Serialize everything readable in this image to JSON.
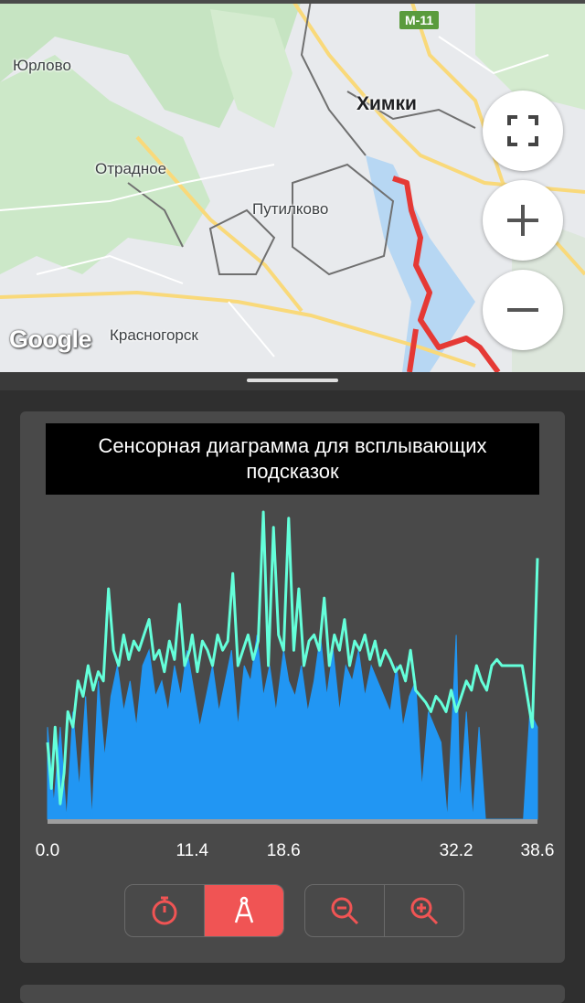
{
  "map": {
    "labels": {
      "yurlovo": "Юрлово",
      "otradnoe": "Отрадное",
      "khimki": "Химки",
      "putilkovo": "Путилково",
      "krasnogorsk": "Красногорск"
    },
    "road_shield": "M-11",
    "logo": "Google",
    "buttons": {
      "fullscreen_icon": "fullscreen-icon",
      "zoom_in_icon": "plus-icon",
      "zoom_out_icon": "minus-icon"
    },
    "track_color": "#e53935"
  },
  "chart_data": {
    "type": "area",
    "title": "Сенсорная диаграмма для всплывающих подсказок",
    "xlabel": "",
    "ylabel": "",
    "xlim": [
      0.0,
      38.6
    ],
    "x_ticks": [
      "0.0",
      "11.4",
      "18.6",
      "32.2",
      "38.6"
    ],
    "grid": false,
    "series": [
      {
        "color": "#2196f3",
        "fill": true,
        "x": [
          0.0,
          0.5,
          1.0,
          1.5,
          2.0,
          2.5,
          3.0,
          3.5,
          4.0,
          4.5,
          5.0,
          5.5,
          6.0,
          6.5,
          7.0,
          7.5,
          8.0,
          8.5,
          9.0,
          9.5,
          10.0,
          10.5,
          11.0,
          11.4,
          12.0,
          12.5,
          13.0,
          13.5,
          14.0,
          14.5,
          15.0,
          15.5,
          16.0,
          16.5,
          17.0,
          17.5,
          18.0,
          18.6,
          19.0,
          19.5,
          20.0,
          20.5,
          21.0,
          21.5,
          22.0,
          22.5,
          23.0,
          23.5,
          24.0,
          24.5,
          25.0,
          25.5,
          26.0,
          26.5,
          27.0,
          27.5,
          28.0,
          28.5,
          29.0,
          29.5,
          30.0,
          30.5,
          31.0,
          31.5,
          32.2,
          32.5,
          33.0,
          33.5,
          34.0,
          34.5,
          35.0,
          35.5,
          36.0,
          36.5,
          37.0,
          37.5,
          38.0,
          38.6
        ],
        "y": [
          0.3,
          0.05,
          0.3,
          0.0,
          0.35,
          0.1,
          0.4,
          0.0,
          0.45,
          0.2,
          0.4,
          0.5,
          0.35,
          0.45,
          0.3,
          0.5,
          0.55,
          0.4,
          0.45,
          0.35,
          0.5,
          0.4,
          0.55,
          0.45,
          0.3,
          0.4,
          0.5,
          0.35,
          0.45,
          0.55,
          0.3,
          0.5,
          0.45,
          0.6,
          0.4,
          0.5,
          0.35,
          0.55,
          0.45,
          0.4,
          0.5,
          0.35,
          0.45,
          0.6,
          0.4,
          0.55,
          0.35,
          0.5,
          0.45,
          0.55,
          0.4,
          0.5,
          0.45,
          0.4,
          0.35,
          0.5,
          0.3,
          0.4,
          0.45,
          0.1,
          0.35,
          0.3,
          0.25,
          0.0,
          0.6,
          0.05,
          0.35,
          0.0,
          0.3,
          0.0,
          0.0,
          0.0,
          0.0,
          0.0,
          0.0,
          0.0,
          0.35,
          0.3
        ]
      },
      {
        "color": "#64ffda",
        "fill": false,
        "x": [
          0.0,
          0.3,
          0.6,
          1.0,
          1.3,
          1.6,
          2.0,
          2.4,
          2.8,
          3.2,
          3.6,
          4.0,
          4.4,
          4.8,
          5.2,
          5.6,
          6.0,
          6.4,
          6.8,
          7.2,
          7.6,
          8.0,
          8.4,
          8.8,
          9.2,
          9.6,
          10.0,
          10.4,
          10.8,
          11.2,
          11.4,
          11.8,
          12.2,
          12.6,
          13.0,
          13.4,
          13.8,
          14.2,
          14.6,
          15.0,
          15.4,
          15.8,
          16.2,
          16.6,
          17.0,
          17.4,
          17.8,
          18.2,
          18.6,
          19.0,
          19.4,
          19.8,
          20.2,
          20.6,
          21.0,
          21.4,
          21.8,
          22.2,
          22.6,
          23.0,
          23.4,
          23.8,
          24.2,
          24.6,
          25.0,
          25.4,
          25.8,
          26.2,
          26.6,
          27.0,
          27.4,
          27.8,
          28.2,
          28.6,
          29.0,
          29.4,
          29.8,
          30.2,
          30.6,
          31.0,
          31.4,
          31.8,
          32.2,
          32.6,
          33.0,
          33.4,
          33.8,
          34.2,
          34.6,
          35.0,
          35.4,
          35.8,
          36.2,
          36.6,
          37.0,
          37.4,
          37.8,
          38.2,
          38.6
        ],
        "y": [
          0.25,
          0.1,
          0.3,
          0.05,
          0.15,
          0.35,
          0.3,
          0.45,
          0.4,
          0.5,
          0.42,
          0.48,
          0.45,
          0.75,
          0.55,
          0.5,
          0.6,
          0.52,
          0.58,
          0.55,
          0.6,
          0.65,
          0.52,
          0.55,
          0.48,
          0.58,
          0.52,
          0.7,
          0.5,
          0.55,
          0.6,
          0.48,
          0.58,
          0.55,
          0.5,
          0.6,
          0.55,
          0.58,
          0.8,
          0.5,
          0.55,
          0.6,
          0.52,
          0.58,
          1.0,
          0.5,
          0.95,
          0.6,
          0.55,
          0.98,
          0.55,
          0.75,
          0.5,
          0.58,
          0.6,
          0.55,
          0.72,
          0.5,
          0.6,
          0.55,
          0.65,
          0.5,
          0.58,
          0.55,
          0.6,
          0.52,
          0.58,
          0.5,
          0.55,
          0.52,
          0.48,
          0.5,
          0.45,
          0.55,
          0.42,
          0.4,
          0.38,
          0.35,
          0.4,
          0.38,
          0.35,
          0.42,
          0.35,
          0.4,
          0.45,
          0.42,
          0.5,
          0.45,
          0.42,
          0.5,
          0.52,
          0.5,
          0.5,
          0.5,
          0.5,
          0.5,
          0.4,
          0.3,
          0.85
        ]
      }
    ]
  },
  "controls": {
    "mode_buttons": [
      {
        "icon": "stopwatch-icon",
        "active": false
      },
      {
        "icon": "compass-divider-icon",
        "active": true
      }
    ],
    "zoom_buttons": [
      {
        "icon": "zoom-out-icon"
      },
      {
        "icon": "zoom-in-icon"
      }
    ],
    "accent_color": "#f05454"
  }
}
